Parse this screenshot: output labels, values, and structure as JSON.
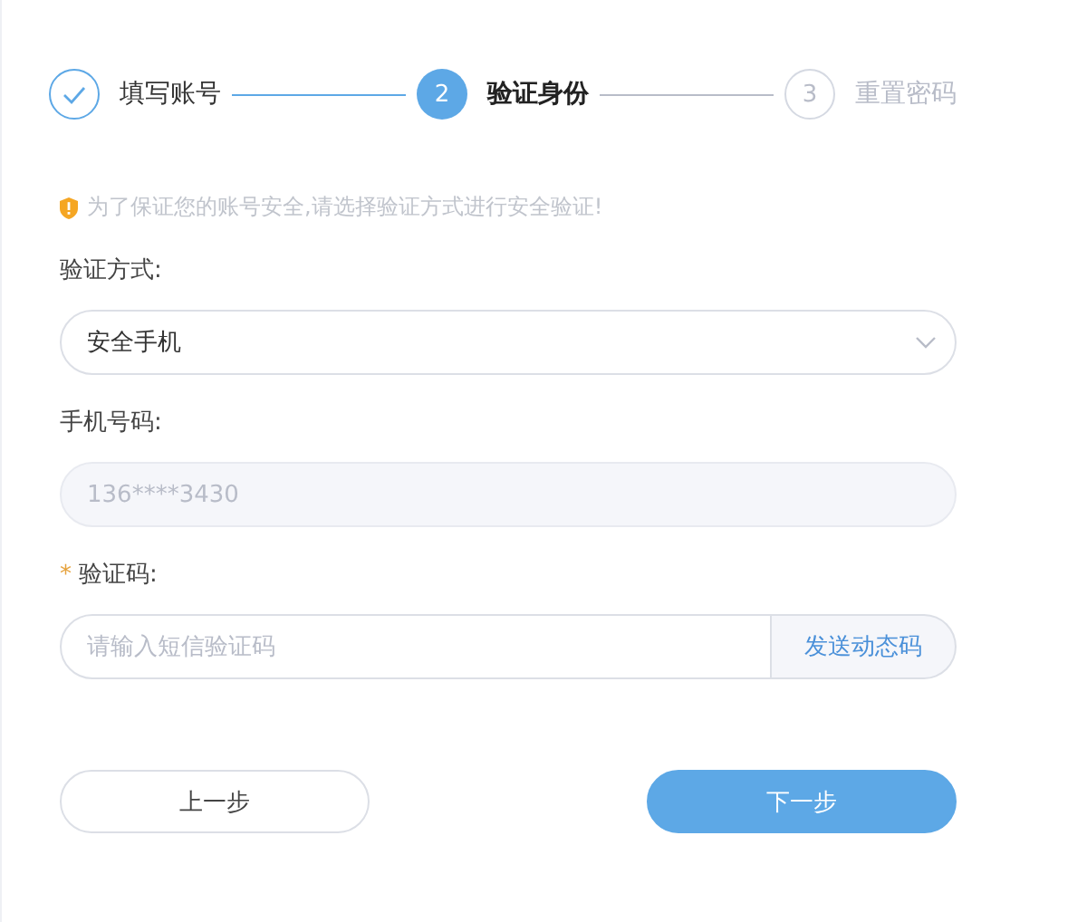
{
  "steps": [
    {
      "label": "填写账号",
      "completed": true,
      "selected": false
    },
    {
      "label": "验证身份",
      "completed": false,
      "selected": true,
      "number": "2"
    },
    {
      "label": "重置密码",
      "completed": false,
      "selected": false,
      "number": "3"
    }
  ],
  "notice": "为了保证您的账号安全,请选择验证方式进行安全验证!",
  "fields": [
    {
      "kind": "select",
      "label": "验证方式:",
      "value": "安全手机"
    },
    {
      "kind": "readonly",
      "label": "手机号码:",
      "value": "136****3430",
      "disabled": true
    },
    {
      "kind": "code",
      "label": "验证码:",
      "marker": "*",
      "placeholder": "请输入短信验证码",
      "button": "发送动态码"
    }
  ],
  "buttons": [
    {
      "label": "上一步",
      "primary": false
    },
    {
      "label": "下一步",
      "primary": true
    }
  ]
}
